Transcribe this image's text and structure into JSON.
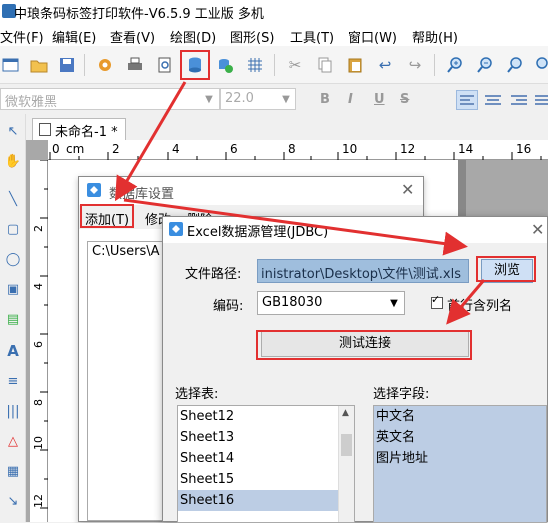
{
  "app": {
    "title": "中琅条码标签打印软件-V6.5.9 工业版 多机"
  },
  "menubar": {
    "items": [
      "文件(F)",
      "编辑(E)",
      "查看(V)",
      "绘图(D)",
      "图形(S)",
      "工具(T)",
      "窗口(W)",
      "帮助(H)"
    ]
  },
  "formatbar": {
    "font": "微软雅黑",
    "size": "22.0",
    "bold": "B",
    "italic": "I",
    "underline": "U",
    "strike": "S"
  },
  "document": {
    "tab_title": "未命名-1 *"
  },
  "ruler": {
    "unit": "cm",
    "top_ticks": [
      "0",
      "2",
      "4",
      "6",
      "8",
      "10",
      "12",
      "14",
      "16"
    ],
    "left_ticks": [
      "2",
      "4",
      "6",
      "8",
      "10",
      "12"
    ]
  },
  "dialog_db": {
    "title": "数据库设置",
    "menu": [
      "添加(T)",
      "修改",
      "删除"
    ],
    "list_item": "C:\\Users\\A"
  },
  "dialog_excel": {
    "title": "Excel数据源管理(JDBC)",
    "file_path_label": "文件路径:",
    "file_path_value": "inistrator\\Desktop\\文件\\测试.xls",
    "browse_label": "浏览",
    "encoding_label": "编码:",
    "encoding_value": "GB18030",
    "first_row_label": "首行含列名",
    "test_label": "测试连接",
    "tables_label": "选择表:",
    "tables": [
      "Sheet12",
      "Sheet13",
      "Sheet14",
      "Sheet15",
      "Sheet16"
    ],
    "selected_table": "Sheet16",
    "fields_label": "选择字段:",
    "fields": [
      "中文名",
      "英文名",
      "图片地址"
    ]
  },
  "colors": {
    "highlight": "#e23030",
    "selection": "#bccde4",
    "path_bg": "#9fbedd"
  }
}
